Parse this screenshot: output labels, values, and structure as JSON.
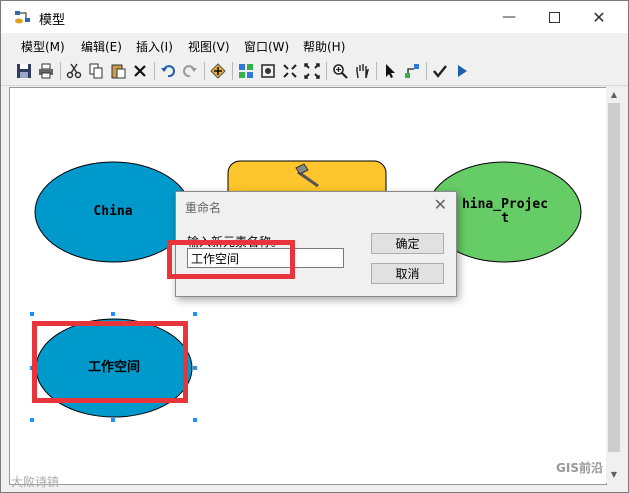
{
  "window": {
    "title": "模型"
  },
  "menu": [
    "模型(M)",
    "编辑(E)",
    "插入(I)",
    "视图(V)",
    "窗口(W)",
    "帮助(H)"
  ],
  "toolbar_icons": [
    "save-icon",
    "print-icon",
    "cut-icon",
    "copy-icon",
    "paste-icon",
    "delete-icon",
    "undo-icon",
    "redo-icon",
    "add-data-icon",
    "auto-layout-icon",
    "full-extent-icon",
    "zoom-in-fixed-icon",
    "zoom-out-fixed-icon",
    "zoom-in-icon",
    "pan-icon",
    "select-icon",
    "connect-icon",
    "validate-icon",
    "run-icon"
  ],
  "nodes": [
    {
      "label": "China",
      "color": "#0099cc"
    },
    {
      "label": "China_Project",
      "line1": "hina_Projec",
      "line2": "t",
      "color": "#66cc66"
    },
    {
      "label": "",
      "color": "#fcc62c"
    },
    {
      "label": "工作空间",
      "color": "#0099cc"
    }
  ],
  "dialog": {
    "title": "重命名",
    "prompt": "输入新元素名称。",
    "input_value": "工作空间",
    "ok_label": "确定",
    "cancel_label": "取消"
  },
  "watermarks": {
    "left": "大败诗镇",
    "right": "GIS前沿"
  },
  "colors": {
    "highlight": "#e8343b",
    "selection": "#1e90ff"
  }
}
